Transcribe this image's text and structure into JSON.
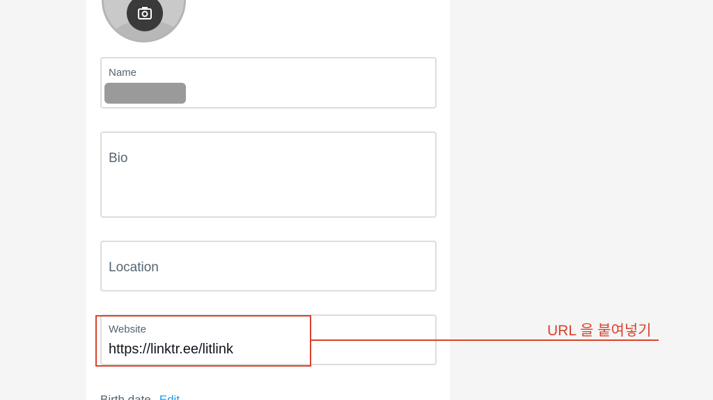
{
  "profile": {
    "name": {
      "label": "Name",
      "value_redacted": true
    },
    "bio": {
      "placeholder": "Bio"
    },
    "location": {
      "placeholder": "Location"
    },
    "website": {
      "label": "Website",
      "value": "https://linktr.ee/litlink"
    },
    "birth_date": {
      "label": "Birth date",
      "edit_link": "Edit"
    }
  },
  "annotation": {
    "text": "URL 을 붙여넣기",
    "color": "#d9422b"
  },
  "icons": {
    "avatar_camera": "camera-icon"
  },
  "colors": {
    "accent": "#1d9bf0",
    "annotation": "#d9422b",
    "field_border": "#dcdcdc"
  }
}
